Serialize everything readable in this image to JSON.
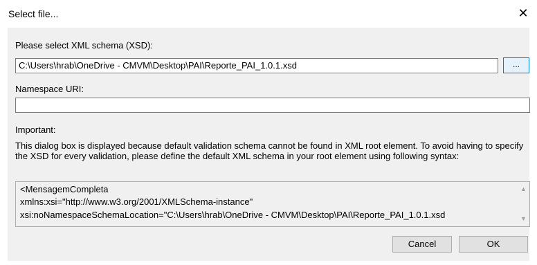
{
  "window": {
    "title": "Select file...",
    "close_glyph": "✕"
  },
  "schema": {
    "label": "Please select XML schema (XSD):",
    "value": "C:\\Users\\hrab\\OneDrive - CMVM\\Desktop\\PAI\\Reporte_PAI_1.0.1.xsd",
    "browse_label": "..."
  },
  "namespace": {
    "label": "Namespace URI:",
    "value": ""
  },
  "important": {
    "label": "Important:",
    "text": "This dialog box is displayed because default validation schema cannot be found in XML root element. To avoid having to specify the XSD for every validation, please define the default XML schema in your root element using following syntax:"
  },
  "syntax": {
    "lines": [
      "<MensagemCompleta",
      "    xmlns:xsi=\"http://www.w3.org/2001/XMLSchema-instance\"",
      "    xsi:noNamespaceSchemaLocation=\"C:\\Users\\hrab\\OneDrive - CMVM\\Desktop\\PAI\\Reporte_PAI_1.0.1.xsd"
    ],
    "scroll_up": "▲",
    "scroll_down": "▼"
  },
  "buttons": {
    "cancel": "Cancel",
    "ok": "OK"
  }
}
